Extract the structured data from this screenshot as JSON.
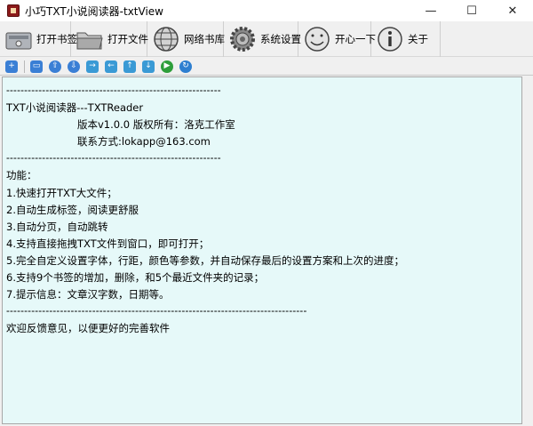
{
  "window": {
    "title": "小巧TXT小说阅读器-txtView",
    "minimize": "—",
    "maximize": "☐",
    "close": "✕"
  },
  "toolbar": {
    "items": [
      {
        "label": "打开书签",
        "icon": "bookmark-drive-icon"
      },
      {
        "label": "打开文件",
        "icon": "folder-icon"
      },
      {
        "label": "网络书库",
        "icon": "globe-icon"
      },
      {
        "label": "系统设置",
        "icon": "gear-icon"
      },
      {
        "label": "开心一下",
        "icon": "smiley-clock-icon"
      },
      {
        "label": "关于",
        "icon": "info-icon"
      }
    ]
  },
  "smallbar": {
    "buttons": [
      "+",
      "▭",
      "⇧",
      "⇩",
      "→",
      "←",
      "↑",
      "↓",
      "▶",
      "↻"
    ],
    "colors": [
      "#3a7fd5",
      "#3a7fd5",
      "#3a7fd5",
      "#3a7fd5",
      "#3a9ad5",
      "#3a9ad5",
      "#3a9ad5",
      "#3a9ad5",
      "#2e9e3a",
      "#2e7fd0"
    ]
  },
  "content": {
    "lines": [
      {
        "text": "------------------------------------------------------------",
        "indent": false
      },
      {
        "text": "TXT小说阅读器---TXTReader",
        "indent": false
      },
      {
        "text": "版本v1.0.0 版权所有：洛克工作室",
        "indent": true
      },
      {
        "text": "联系方式:lokapp@163.com",
        "indent": true
      },
      {
        "text": "------------------------------------------------------------",
        "indent": false
      },
      {
        "text": "功能：",
        "indent": false
      },
      {
        "text": "1.快速打开TXT大文件；",
        "indent": false
      },
      {
        "text": "2.自动生成标签，阅读更舒服",
        "indent": false
      },
      {
        "text": "3.自动分页，自动跳转",
        "indent": false
      },
      {
        "text": "4.支持直接拖拽TXT文件到窗口，即可打开；",
        "indent": false
      },
      {
        "text": "5.完全自定义设置字体，行距，颜色等参数，并自动保存最后的设置方案和上次的进度；",
        "indent": false
      },
      {
        "text": "6.支持9个书签的增加，删除，和5个最近文件夹的记录；",
        "indent": false
      },
      {
        "text": "7.提示信息：文章汉字数，日期等。",
        "indent": false
      },
      {
        "text": "------------------------------------------------------------------------------------",
        "indent": false
      },
      {
        "text": "欢迎反馈意见，以便更好的完善软件",
        "indent": false
      }
    ]
  },
  "colors": {
    "content_bg": "#e6f9f9",
    "window_bg": "#f0f0f0"
  }
}
